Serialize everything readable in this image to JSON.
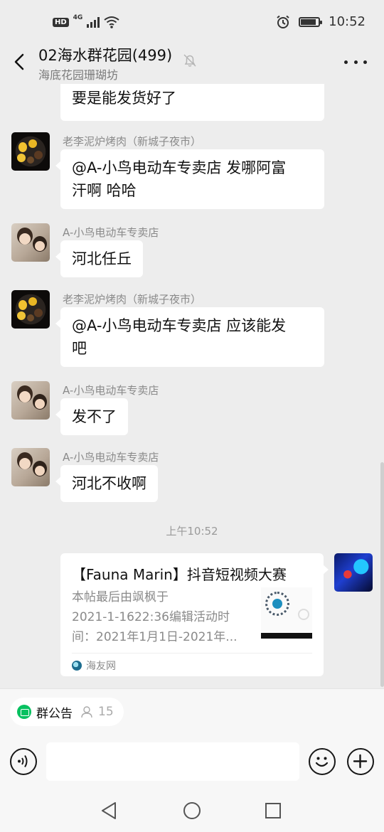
{
  "status_bar": {
    "hd": "HD",
    "network": "4G",
    "time": "10:52",
    "battery_level": 0.8
  },
  "header": {
    "title": "02海水群花园(499)",
    "subtitle": "海底花园珊瑚坊"
  },
  "messages": [
    {
      "id": "m0",
      "sender": "",
      "text": "要是能发货好了",
      "partial": true
    },
    {
      "id": "m1",
      "sender": "老李泥炉烤肉（新城子夜市）",
      "avatar": "food-avatar",
      "lines": [
        "@A-小鸟电动车专卖店  发哪阿富",
        "汗啊  哈哈"
      ]
    },
    {
      "id": "m2",
      "sender": "A-小鸟电动车专卖店",
      "avatar": "kids-avatar",
      "lines": [
        "河北任丘"
      ]
    },
    {
      "id": "m3",
      "sender": "老李泥炉烤肉（新城子夜市）",
      "avatar": "food-avatar",
      "lines": [
        "@A-小鸟电动车专卖店  应该能发",
        "吧"
      ]
    },
    {
      "id": "m4",
      "sender": "A-小鸟电动车专卖店",
      "avatar": "kids-avatar",
      "lines": [
        "发不了"
      ]
    },
    {
      "id": "m5",
      "sender": "A-小鸟电动车专卖店",
      "avatar": "kids-avatar",
      "lines": [
        "河北不收啊"
      ]
    }
  ],
  "time_separator": "上午10:52",
  "link_card": {
    "title": "【Fauna Marin】抖音短视频大赛",
    "desc_lines": [
      "本帖最后由飒枫于",
      "2021-1-1622:36编辑活动时",
      "间：2021年1月1日-2021年..."
    ],
    "source": "海友网"
  },
  "notice": {
    "label": "群公告",
    "member_count": "15"
  },
  "input": {
    "placeholder": ""
  },
  "colors": {
    "background": "#ededed",
    "accent": "#07c160",
    "bubble": "#ffffff"
  }
}
